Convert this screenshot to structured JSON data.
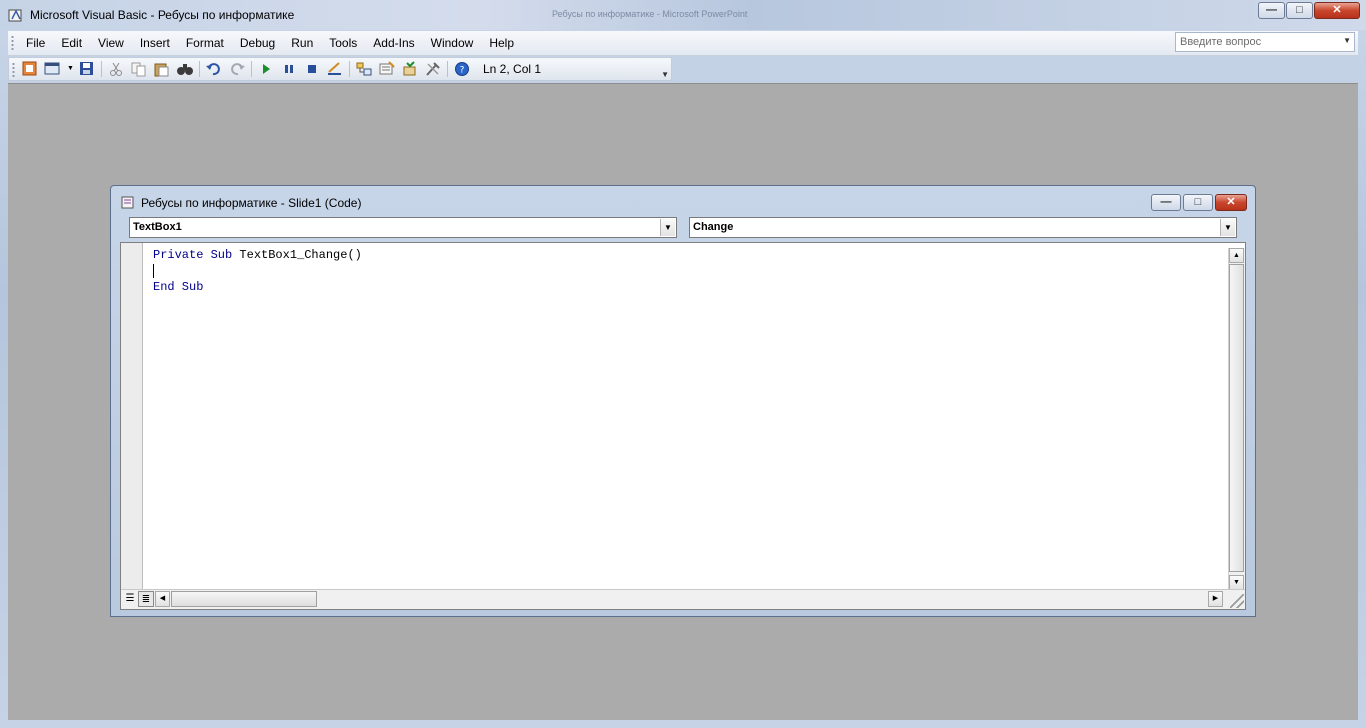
{
  "window": {
    "title": "Microsoft Visual Basic - Ребусы по информатике",
    "background_title": "Ребусы по информатике - Microsoft PowerPoint",
    "minimize_glyph": "—",
    "maximize_glyph": "□",
    "close_glyph": "✕"
  },
  "menu": {
    "items": [
      "File",
      "Edit",
      "View",
      "Insert",
      "Format",
      "Debug",
      "Run",
      "Tools",
      "Add-Ins",
      "Window",
      "Help"
    ]
  },
  "help_search": {
    "placeholder": "Введите вопрос"
  },
  "toolbar": {
    "status": "Ln 2, Col 1",
    "icons": [
      "powerpoint-icon",
      "insert-userform-icon",
      "save-icon",
      "cut-icon",
      "copy-icon",
      "paste-icon",
      "find-icon",
      "undo-icon",
      "redo-icon",
      "run-icon",
      "break-icon",
      "reset-icon",
      "design-mode-icon",
      "project-explorer-icon",
      "properties-icon",
      "object-browser-icon",
      "toolbox-icon",
      "help-icon"
    ]
  },
  "code_window": {
    "title": "Ребусы по информатике - Slide1 (Code)",
    "object_combo": "TextBox1",
    "procedure_combo": "Change",
    "lines": [
      {
        "kw1": "Private Sub",
        "rest": " TextBox1_Change()"
      },
      {
        "kw1": "",
        "rest": ""
      },
      {
        "kw1": "End Sub",
        "rest": ""
      }
    ]
  },
  "colors": {
    "keyword": "#00008b",
    "mdi_background": "#ababab",
    "title_bar": "#c5d3e6"
  }
}
